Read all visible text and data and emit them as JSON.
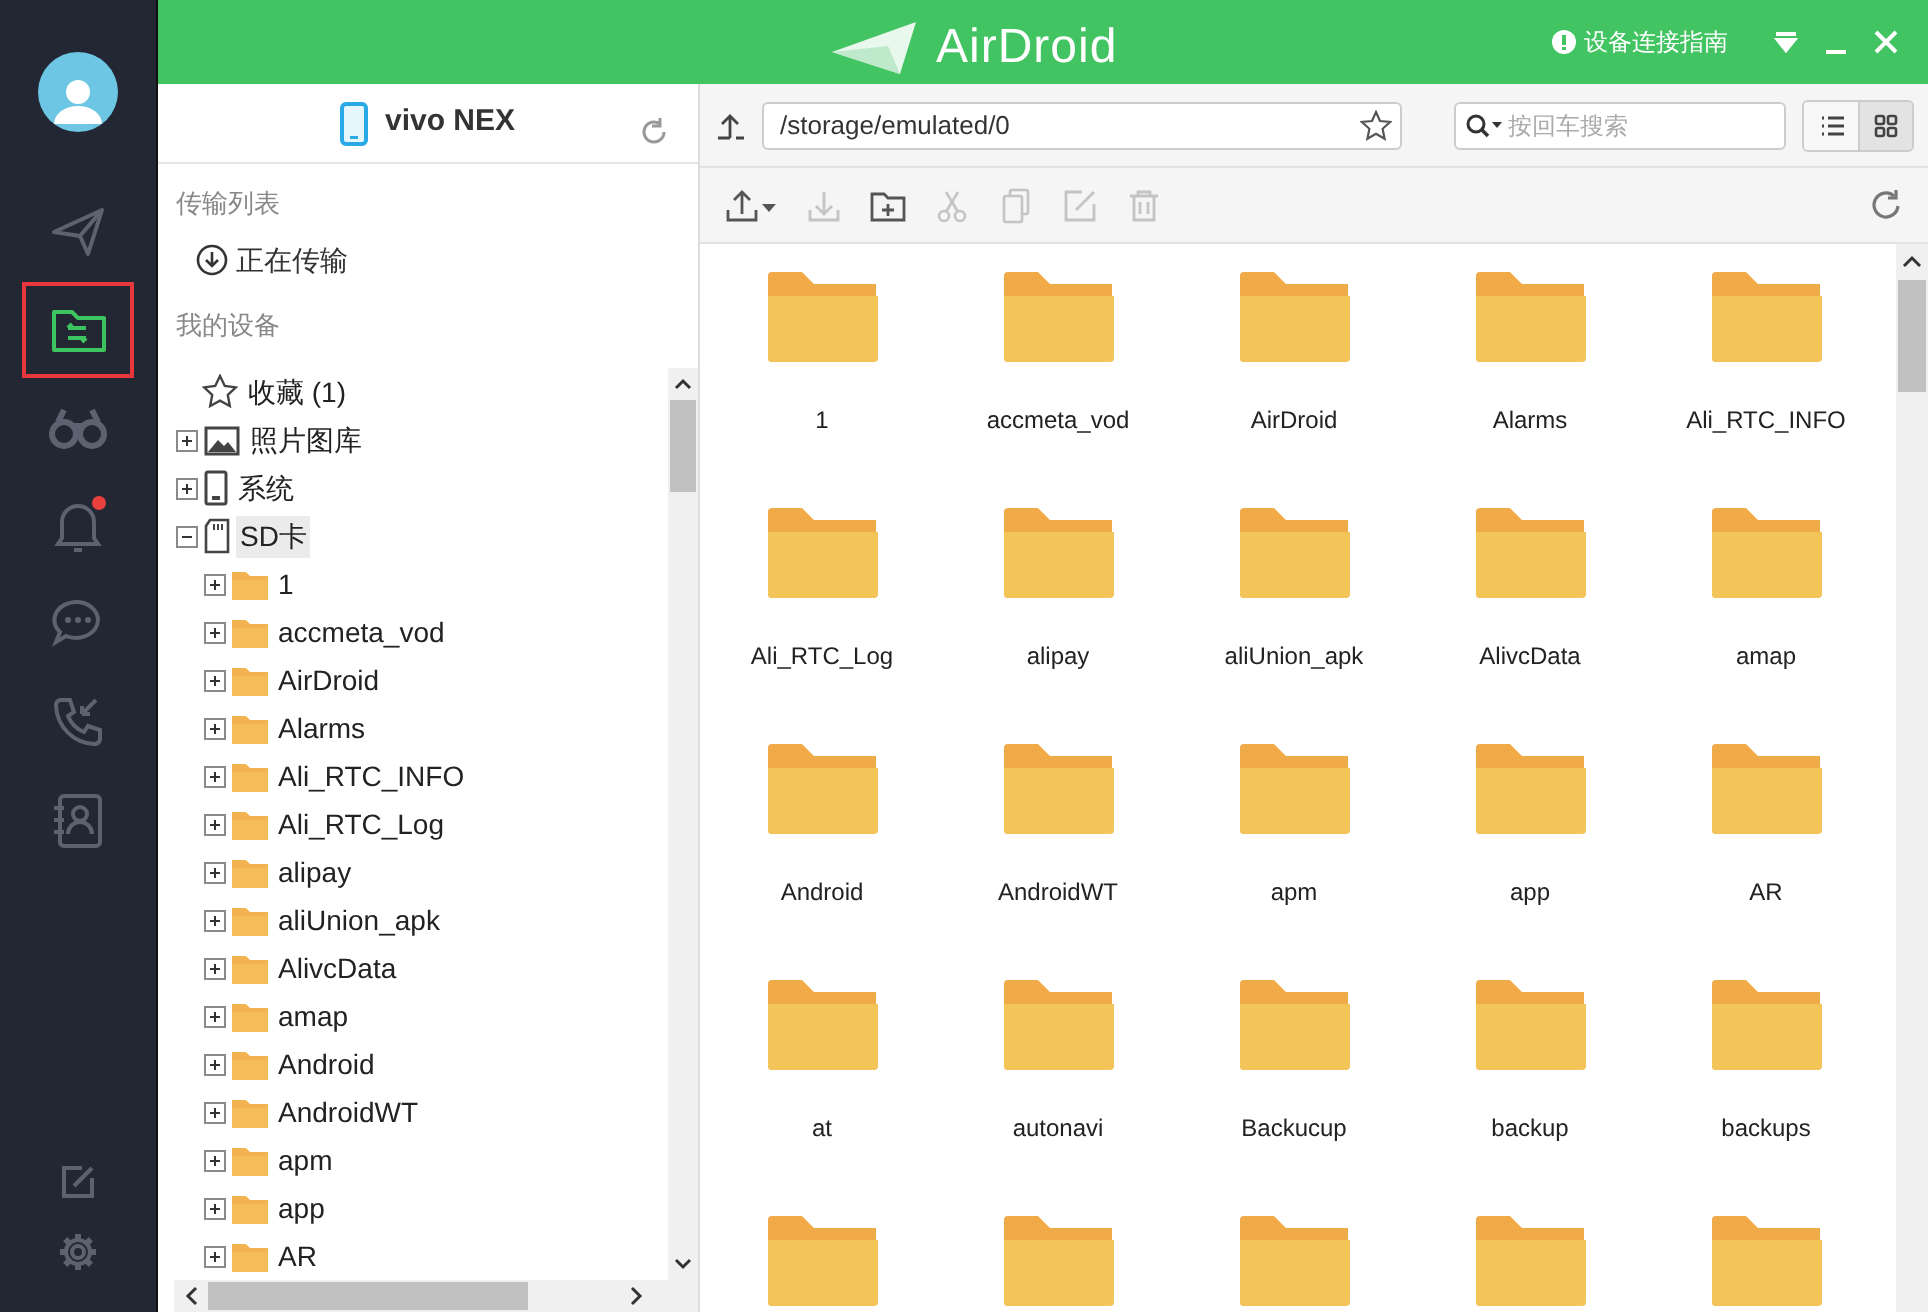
{
  "sidebar": {
    "items": [
      {
        "kind": "send",
        "selected": false
      },
      {
        "kind": "files",
        "selected": true
      },
      {
        "kind": "binoculars",
        "selected": false
      },
      {
        "kind": "bell",
        "selected": false,
        "unread": true
      },
      {
        "kind": "chat",
        "selected": false
      },
      {
        "kind": "calls",
        "selected": false
      },
      {
        "kind": "contacts",
        "selected": false
      }
    ],
    "bottom_items": [
      {
        "kind": "edit"
      },
      {
        "kind": "settings"
      }
    ]
  },
  "title_bar": {
    "app_name": "AirDroid",
    "guide_link": "设备连接指南"
  },
  "device_panel": {
    "device_name": "vivo NEX",
    "transfer_heading": "传输列表",
    "transfer_item": "正在传输",
    "devices_heading": "我的设备",
    "tree": [
      {
        "label": "收藏 (1)",
        "kind": "favorites",
        "selected": false
      },
      {
        "label": "照片图库",
        "kind": "gallery",
        "expanded": false,
        "selected": false
      },
      {
        "label": "系统",
        "kind": "phone",
        "expanded": false,
        "selected": false
      },
      {
        "label": "SD卡",
        "kind": "sdcard",
        "expanded": true,
        "selected": true,
        "children": [
          {
            "label": "1",
            "kind": "folder",
            "expanded": false,
            "selected": false
          },
          {
            "label": "accmeta_vod",
            "kind": "folder",
            "expanded": false,
            "selected": false
          },
          {
            "label": "AirDroid",
            "kind": "folder",
            "expanded": false,
            "selected": false
          },
          {
            "label": "Alarms",
            "kind": "folder",
            "expanded": false,
            "selected": false
          },
          {
            "label": "Ali_RTC_INFO",
            "kind": "folder",
            "expanded": false,
            "selected": false
          },
          {
            "label": "Ali_RTC_Log",
            "kind": "folder",
            "expanded": false,
            "selected": false
          },
          {
            "label": "alipay",
            "kind": "folder",
            "expanded": false,
            "selected": false
          },
          {
            "label": "aliUnion_apk",
            "kind": "folder",
            "expanded": false,
            "selected": false
          },
          {
            "label": "AlivcData",
            "kind": "folder",
            "expanded": false,
            "selected": false
          },
          {
            "label": "amap",
            "kind": "folder",
            "expanded": false,
            "selected": false
          },
          {
            "label": "Android",
            "kind": "folder",
            "expanded": false,
            "selected": false
          },
          {
            "label": "AndroidWT",
            "kind": "folder",
            "expanded": false,
            "selected": false
          },
          {
            "label": "apm",
            "kind": "folder",
            "expanded": false,
            "selected": false
          },
          {
            "label": "app",
            "kind": "folder",
            "expanded": false,
            "selected": false
          },
          {
            "label": "AR",
            "kind": "folder",
            "expanded": false,
            "selected": false
          }
        ]
      }
    ]
  },
  "path_bar": {
    "path": "/storage/emulated/0",
    "search_placeholder": "按回车搜索",
    "views": [
      {
        "kind": "list",
        "selected": false
      },
      {
        "kind": "grid",
        "selected": true
      }
    ]
  },
  "toolbar": [
    {
      "kind": "upload",
      "disabled": false
    },
    {
      "kind": "download",
      "disabled": true
    },
    {
      "kind": "new-folder",
      "disabled": false
    },
    {
      "kind": "cut",
      "disabled": true
    },
    {
      "kind": "copy",
      "disabled": true
    },
    {
      "kind": "rename",
      "disabled": true
    },
    {
      "kind": "delete",
      "disabled": true
    }
  ],
  "files": [
    {
      "kind": "folder",
      "name": "1"
    },
    {
      "kind": "folder",
      "name": "accmeta_vod"
    },
    {
      "kind": "folder",
      "name": "AirDroid"
    },
    {
      "kind": "folder",
      "name": "Alarms"
    },
    {
      "kind": "folder",
      "name": "Ali_RTC_INFO"
    },
    {
      "kind": "folder",
      "name": "Ali_RTC_Log"
    },
    {
      "kind": "folder",
      "name": "alipay"
    },
    {
      "kind": "folder",
      "name": "aliUnion_apk"
    },
    {
      "kind": "folder",
      "name": "AlivcData"
    },
    {
      "kind": "folder",
      "name": "amap"
    },
    {
      "kind": "folder",
      "name": "Android"
    },
    {
      "kind": "folder",
      "name": "AndroidWT"
    },
    {
      "kind": "folder",
      "name": "apm"
    },
    {
      "kind": "folder",
      "name": "app"
    },
    {
      "kind": "folder",
      "name": "AR"
    },
    {
      "kind": "folder",
      "name": "at"
    },
    {
      "kind": "folder",
      "name": "autonavi"
    },
    {
      "kind": "folder",
      "name": "Backucup"
    },
    {
      "kind": "folder",
      "name": "backup"
    },
    {
      "kind": "folder",
      "name": "backups"
    },
    {
      "kind": "folder"
    },
    {
      "kind": "folder"
    },
    {
      "kind": "folder"
    },
    {
      "kind": "folder"
    },
    {
      "kind": "folder"
    }
  ]
}
